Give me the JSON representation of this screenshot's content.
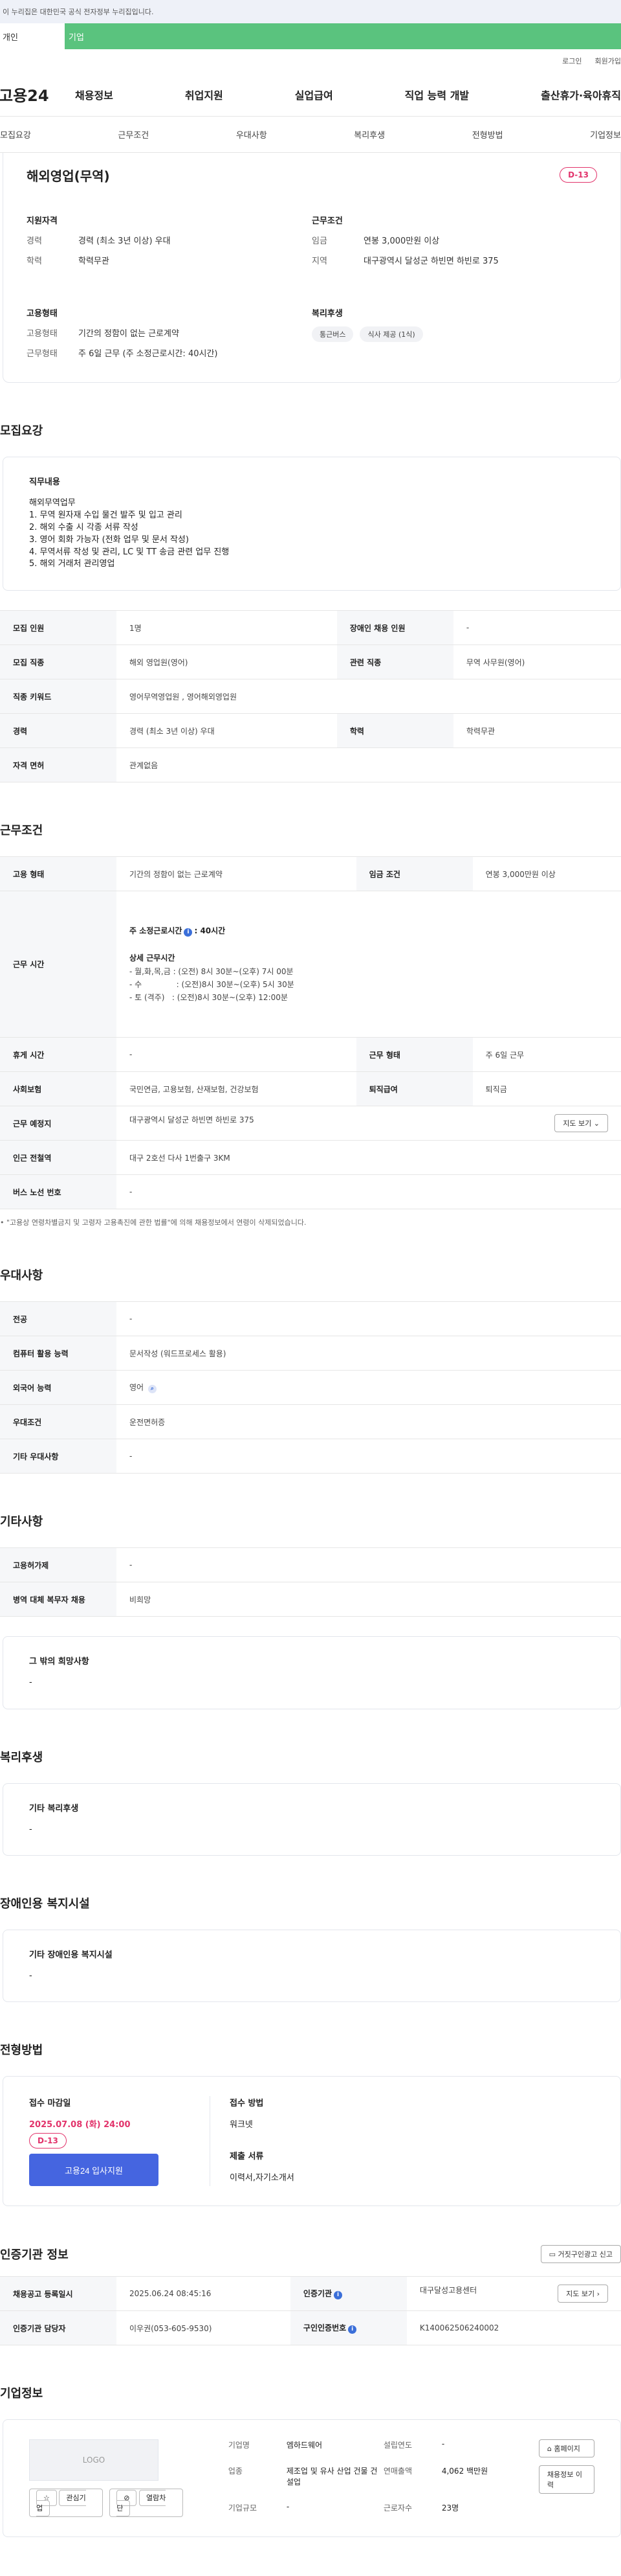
{
  "gov_banner": "이 누리집은 대한민국 공식 전자정부 누리집입니다.",
  "role_tabs": {
    "person": "개인",
    "company": "기업"
  },
  "util": {
    "login": "로그인",
    "join": "회원가입"
  },
  "logo": "고용24",
  "gnb": [
    "채용정보",
    "취업지원",
    "실업급여",
    "직업 능력 개발",
    "출산휴가·육아휴직"
  ],
  "sub_tabs": [
    "모집요강",
    "근무조건",
    "우대사항",
    "복리후생",
    "전형방법",
    "기업정보"
  ],
  "title": "해외영업(무역)",
  "dday": "D-13",
  "summary": {
    "qual_title": "지원자격",
    "career_key": "경력",
    "career_val": "경력 (최소 3년 이상) 우대",
    "edu_key": "학력",
    "edu_val": "학력무관",
    "cond_title": "근무조건",
    "wage_key": "임금",
    "wage_val": "연봉 3,000만원 이상",
    "region_key": "지역",
    "region_val": "대구광역시 달성군 하빈면 하빈로 375",
    "emp_title": "고용형태",
    "emp_key": "고용형태",
    "emp_val": "기간의 정함이 없는 근로계약",
    "worktype_key": "근무형태",
    "worktype_val": "주 6일 근무 (주 소정근로시간: 40시간)",
    "welfare_title": "복리후생",
    "welfare_chips": [
      "통근버스",
      "식사 제공 (1식)"
    ]
  },
  "recruit": {
    "section_title": "모집요강",
    "duty_title": "직무내용",
    "duty_lines": [
      "해외무역업무",
      "1. 무역 원자재 수입 물건 발주 및 입고 관리",
      "2. 해외 수출 시 각종 서류 작성",
      "3. 영어 회화 가능자 (전화 업무 및 문서 작성)",
      "4. 무역서류 작성 및 관리, LC 및 TT 송금 관련 업무 진행",
      "5. 해외 거래처 관리영업"
    ],
    "rows": [
      [
        "모집 인원",
        "1명",
        "장애인 채용 인원",
        "-"
      ],
      [
        "모집 직종",
        "해외 영업원(영어)",
        "관련 직종",
        "무역 사무원(영어)"
      ],
      [
        "직종 키워드",
        "영어무역영업원 , 영어해외영업원",
        "",
        ""
      ],
      [
        "경력",
        "경력 (최소 3년 이상) 우대",
        "학력",
        "학력무관"
      ],
      [
        "자격 면허",
        "관계없음",
        "",
        ""
      ]
    ]
  },
  "work": {
    "section_title": "근무조건",
    "emp_key": "고용 형태",
    "emp_val": "기간의 정함이 없는 근로계약",
    "wage_key": "임금 조건",
    "wage_val": "연봉 3,000만원 이상",
    "hours_key": "근무 시간",
    "weekly_label": "주 소정근로시간",
    "weekly_val": ": 40시간",
    "detail_title": "상세 근무시간",
    "detail_lines": [
      "- 월,화,목,금 : (오전) 8시 30분~(오후) 7시 00분",
      "- 수              : (오전)8시 30분~(오후) 5시 30분",
      "- 토 (격주)   : (오전)8시 30분~(오후) 12:00분"
    ],
    "holiday_key": "휴게 시간",
    "holiday_val": "-",
    "worktype_key": "근무 형태",
    "worktype_val": "주 6일 근무",
    "insure_key": "사회보험",
    "insure_val": "국민연금, 고용보험, 산재보험, 건강보험",
    "retire_key": "퇴직급여",
    "retire_val": "퇴직금",
    "place_key": "근무 예정지",
    "place_val": "대구광역시 달성군 하빈면 하빈로 375",
    "map_btn": "지도 보기",
    "subway_key": "인근 전철역",
    "subway_val": "대구 2호선 다사 1번출구 3KM",
    "bus_key": "버스 노선 번호",
    "bus_val": "-",
    "note": "\"고용상 연령차별금지 및 고령자 고용촉진에 관한 법률\"에 의해 채용정보에서 연령이 삭제되었습니다."
  },
  "pref": {
    "section_title": "우대사항",
    "rows": [
      [
        "전공",
        "-"
      ],
      [
        "컴퓨터 활용 능력",
        "문서작성 (워드프로세스 활용)"
      ],
      [
        "외국어 능력",
        "영어"
      ],
      [
        "우대조건",
        "운전면허증"
      ],
      [
        "기타 우대사항",
        "-"
      ]
    ]
  },
  "etc": {
    "section_title": "기타사항",
    "rows": [
      [
        "고용허가제",
        "-"
      ],
      [
        "병역 대체 복무자 채용",
        "비희망"
      ]
    ],
    "wish_title": "그 밖의 희망사항",
    "wish_val": "-"
  },
  "welfare": {
    "section_title": "복리후생",
    "box_title": "기타 복리후생",
    "box_val": "-"
  },
  "disabled": {
    "section_title": "장애인용 복지시설",
    "box_title": "기타 장애인용 복지시설",
    "box_val": "-"
  },
  "apply": {
    "section_title": "전형방법",
    "deadline_label": "접수 마감일",
    "deadline_val": "2025.07.08 (화) 24:00",
    "dday": "D-13",
    "apply_btn": "고용24 입사지원",
    "method_label": "접수 방법",
    "method_val": "워크넷",
    "docs_label": "제출 서류",
    "docs_val": "이력서,자기소개서"
  },
  "cert": {
    "section_title": "인증기관 정보",
    "report_btn": "거짓구인광고 신고",
    "rows": [
      [
        "채용공고 등록일시",
        "2025.06.24 08:45:16",
        "인증기관",
        "대구달성고용센터",
        "지도 보기"
      ],
      [
        "인증기관 담당자",
        "이우권(053-605-9530)",
        "구인인증번호",
        "K140062506240002",
        ""
      ]
    ]
  },
  "company": {
    "section_title": "기업정보",
    "logo_text": "LOGO",
    "fav_btn": "관심기업",
    "block_btn": "열람차단",
    "name_key": "기업명",
    "name_val": "엠하드웨어",
    "est_key": "설립연도",
    "est_val": "-",
    "ind_key": "업종",
    "ind_val": "제조업 및 유사 산업 건물 건설업",
    "sales_key": "연매출액",
    "sales_val": "4,062 백만원",
    "emp_key": "근로자수",
    "emp_val": "23명",
    "size_key": "기업규모",
    "size_val": "-",
    "home_btn": "홈페이지",
    "history_btn": "채용정보 이력"
  }
}
